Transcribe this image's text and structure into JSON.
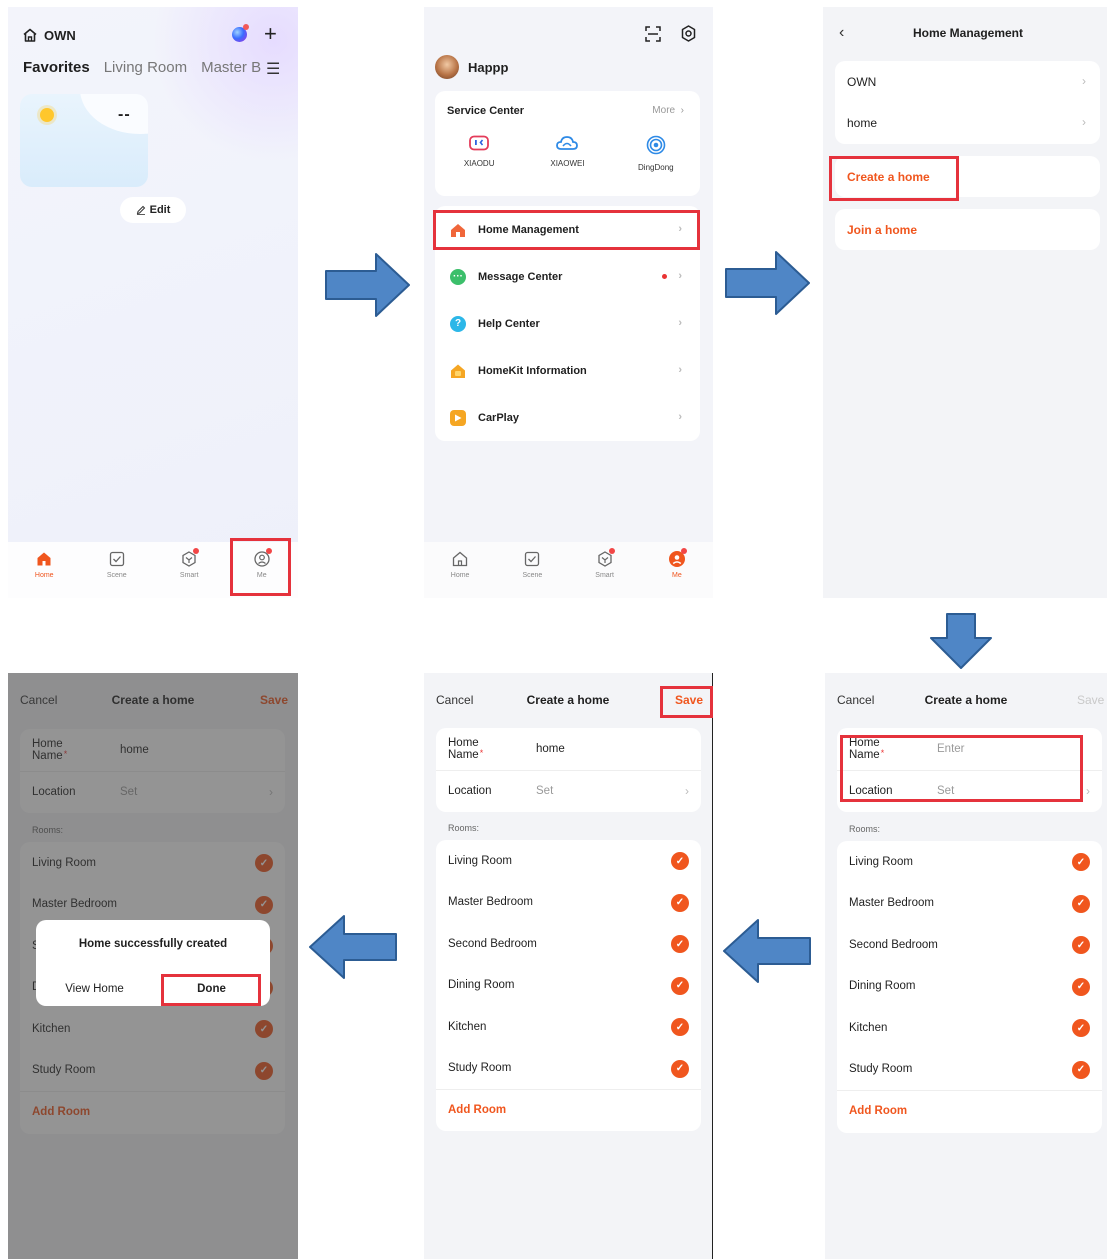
{
  "panel1": {
    "home_title": "OWN",
    "tabs": [
      "Favorites",
      "Living Room",
      "Master B"
    ],
    "temperature": "--",
    "edit_label": "Edit",
    "tabbar": [
      "Home",
      "Scene",
      "Smart",
      "Me"
    ]
  },
  "panel2": {
    "user_name": "Happp",
    "service_center": "Service Center",
    "more": "More",
    "services": [
      "XIAODU",
      "XIAOWEI",
      "DingDong"
    ],
    "menu": [
      "Home Management",
      "Message Center",
      "Help Center",
      "HomeKit Information",
      "CarPlay"
    ],
    "tabbar": [
      "Home",
      "Scene",
      "Smart",
      "Me"
    ]
  },
  "panel3": {
    "title": "Home Management",
    "homes": [
      "OWN",
      "home"
    ],
    "create_home": "Create a home",
    "join_home": "Join a home"
  },
  "form": {
    "cancel": "Cancel",
    "title": "Create a home",
    "save": "Save",
    "home_name_label": "Home Name",
    "required_mark": "*",
    "home_name_placeholder": "Enter",
    "home_name_value": "home",
    "location_label": "Location",
    "location_value": "Set",
    "rooms_label": "Rooms:",
    "rooms": [
      "Living Room",
      "Master Bedroom",
      "Second Bedroom",
      "Dining Room",
      "Kitchen",
      "Study Room"
    ],
    "add_room": "Add Room"
  },
  "dialog": {
    "message": "Home successfully created",
    "view_home": "View Home",
    "done": "Done"
  },
  "colors": {
    "accent": "#f0561e",
    "highlight_box": "#e5323c",
    "arrow_fill": "#4f86c6",
    "arrow_stroke": "#2c5c93"
  }
}
